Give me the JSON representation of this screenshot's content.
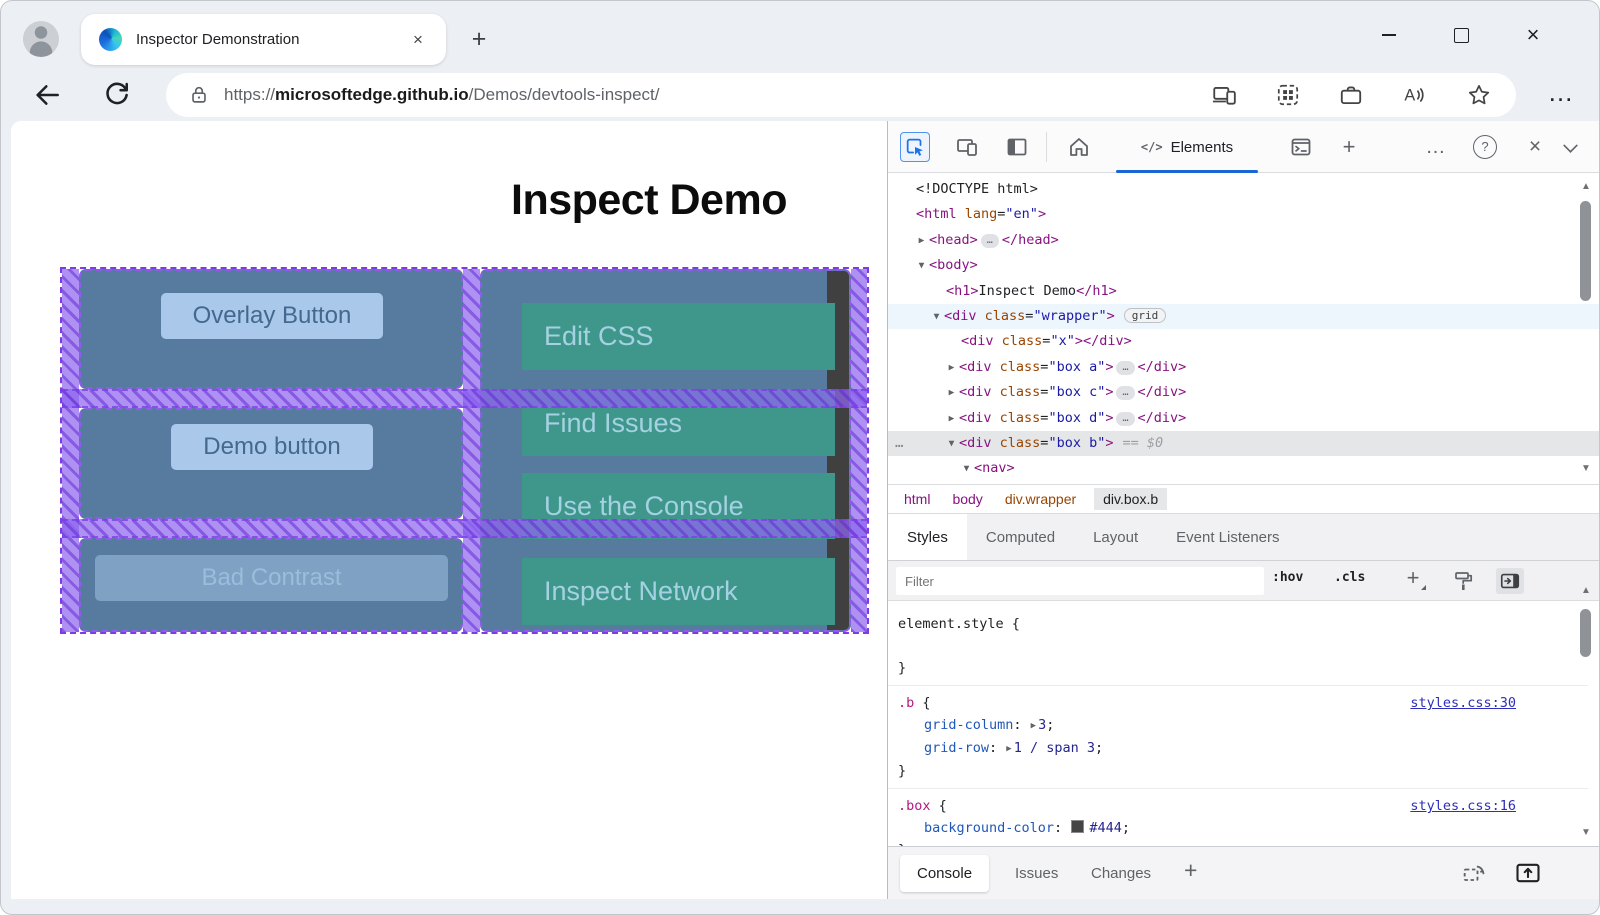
{
  "titlebar": {
    "tab_title": "Inspector Demonstration"
  },
  "addressbar": {
    "scheme": "https://",
    "host": "microsoftedge.github.io",
    "path": "/Demos/devtools-inspect/"
  },
  "icons": {
    "new_tab": "+",
    "tab_close": "×",
    "window_close": "×",
    "more_horizontal": "…",
    "devtools_more": "…",
    "devtools_plus": "+",
    "devtools_close": "×",
    "code": "</>",
    "help": "?",
    "arrow_down": "▼",
    "arrow_right": "▶",
    "expand_value": "▶",
    "scroll_up": "▲",
    "scroll_down": "▼",
    "ellipsis": "…",
    "gutter_dots": "…",
    "hov": ":hov",
    "cls": ".cls",
    "filter_plus": "+",
    "drawer_plus": "+"
  },
  "colors": {
    "accent_blue": "#1a73e8",
    "tag": "#881280",
    "attr": "#994500",
    "attr_value": "#1a1aa6",
    "selector": "#b01a7d",
    "property": "#2058b8",
    "overlay_purple": "#8f5bee",
    "box_blue": "#567b9e",
    "button_blue": "#a9c8ea",
    "link_teal": "#3f978c",
    "dark_box": "#404040"
  },
  "page": {
    "heading": "Inspect Demo",
    "boxes": [
      {
        "name": "box-a",
        "button": "Overlay Button",
        "variant": "normal"
      },
      {
        "name": "box-c",
        "button": "Demo button",
        "variant": "normal"
      },
      {
        "name": "box-d",
        "button": "Bad Contrast",
        "variant": "low-contrast"
      }
    ],
    "nav_links": [
      "Edit CSS",
      "Find Issues",
      "Use the Console",
      "Inspect Network"
    ]
  },
  "devtools": {
    "toolbar": {
      "elements_label": "Elements"
    },
    "dom_tree": [
      {
        "indent": 0,
        "tokens": [
          [
            "d",
            "<!DOCTYPE html>"
          ]
        ]
      },
      {
        "indent": 0,
        "tokens": [
          [
            "t",
            "<html"
          ],
          [
            "a",
            " lang"
          ],
          [
            "p",
            "="
          ],
          [
            "v",
            "\"en\""
          ],
          [
            "t",
            ">"
          ]
        ]
      },
      {
        "indent": 1,
        "arrow": "right",
        "tokens": [
          [
            "t",
            "<head>"
          ],
          [
            "e",
            "…"
          ],
          [
            "t",
            "</head>"
          ]
        ]
      },
      {
        "indent": 1,
        "arrow": "down",
        "tokens": [
          [
            "t",
            "<body>"
          ]
        ]
      },
      {
        "indent": 2,
        "tokens": [
          [
            "t",
            "<h1>"
          ],
          [
            "p",
            "Inspect Demo"
          ],
          [
            "t",
            "</h1>"
          ]
        ]
      },
      {
        "indent": 2,
        "arrow": "down",
        "state": "hover",
        "badge": "grid",
        "tokens": [
          [
            "t",
            "<div"
          ],
          [
            "a",
            " class"
          ],
          [
            "p",
            "="
          ],
          [
            "v",
            "\"wrapper\""
          ],
          [
            "t",
            ">"
          ]
        ]
      },
      {
        "indent": 3,
        "tokens": [
          [
            "t",
            "<div"
          ],
          [
            "a",
            " class"
          ],
          [
            "p",
            "="
          ],
          [
            "v",
            "\"x\""
          ],
          [
            "t",
            ">"
          ],
          [
            "t",
            "</div>"
          ]
        ]
      },
      {
        "indent": 3,
        "arrow": "right",
        "tokens": [
          [
            "t",
            "<div"
          ],
          [
            "a",
            " class"
          ],
          [
            "p",
            "="
          ],
          [
            "v",
            "\"box a\""
          ],
          [
            "t",
            ">"
          ],
          [
            "e",
            "…"
          ],
          [
            "t",
            "</div>"
          ]
        ]
      },
      {
        "indent": 3,
        "arrow": "right",
        "tokens": [
          [
            "t",
            "<div"
          ],
          [
            "a",
            " class"
          ],
          [
            "p",
            "="
          ],
          [
            "v",
            "\"box c\""
          ],
          [
            "t",
            ">"
          ],
          [
            "e",
            "…"
          ],
          [
            "t",
            "</div>"
          ]
        ]
      },
      {
        "indent": 3,
        "arrow": "right",
        "tokens": [
          [
            "t",
            "<div"
          ],
          [
            "a",
            " class"
          ],
          [
            "p",
            "="
          ],
          [
            "v",
            "\"box d\""
          ],
          [
            "t",
            ">"
          ],
          [
            "e",
            "…"
          ],
          [
            "t",
            "</div>"
          ]
        ]
      },
      {
        "indent": 3,
        "arrow": "down",
        "state": "selected",
        "gutter": "…",
        "suffix": "== $0",
        "tokens": [
          [
            "t",
            "<div"
          ],
          [
            "a",
            " class"
          ],
          [
            "p",
            "="
          ],
          [
            "v",
            "\"box b\""
          ],
          [
            "t",
            ">"
          ]
        ]
      },
      {
        "indent": 4,
        "arrow": "down",
        "tokens": [
          [
            "t",
            "<nav>"
          ]
        ]
      }
    ],
    "breadcrumbs": [
      {
        "label": "html",
        "kind": "tag"
      },
      {
        "label": "body",
        "kind": "tag"
      },
      {
        "label": "div.wrapper",
        "kind": "class"
      },
      {
        "label": "div.box.b",
        "kind": "active"
      }
    ],
    "sidebar_tabs": [
      {
        "label": "Styles",
        "active": true
      },
      {
        "label": "Computed",
        "active": false
      },
      {
        "label": "Layout",
        "active": false
      },
      {
        "label": "Event Listeners",
        "active": false
      }
    ],
    "filter_placeholder": "Filter",
    "style_rules": [
      {
        "selector": "element.style",
        "stype": "plain",
        "link": "",
        "spacer": true,
        "decls": []
      },
      {
        "selector": ".b",
        "stype": "class",
        "link": "styles.css:30",
        "spacer": false,
        "decls": [
          {
            "prop": "grid-column",
            "val": "3",
            "arrow": true
          },
          {
            "prop": "grid-row",
            "val": "1 / span 3",
            "arrow": true
          }
        ]
      },
      {
        "selector": ".box",
        "stype": "class",
        "link": "styles.css:16",
        "spacer": false,
        "decls": [
          {
            "prop": "background-color",
            "val": "#444",
            "swatch": "#444"
          }
        ]
      }
    ],
    "drawer_tabs": [
      {
        "label": "Console",
        "active": true
      },
      {
        "label": "Issues",
        "active": false
      },
      {
        "label": "Changes",
        "active": false
      }
    ]
  }
}
